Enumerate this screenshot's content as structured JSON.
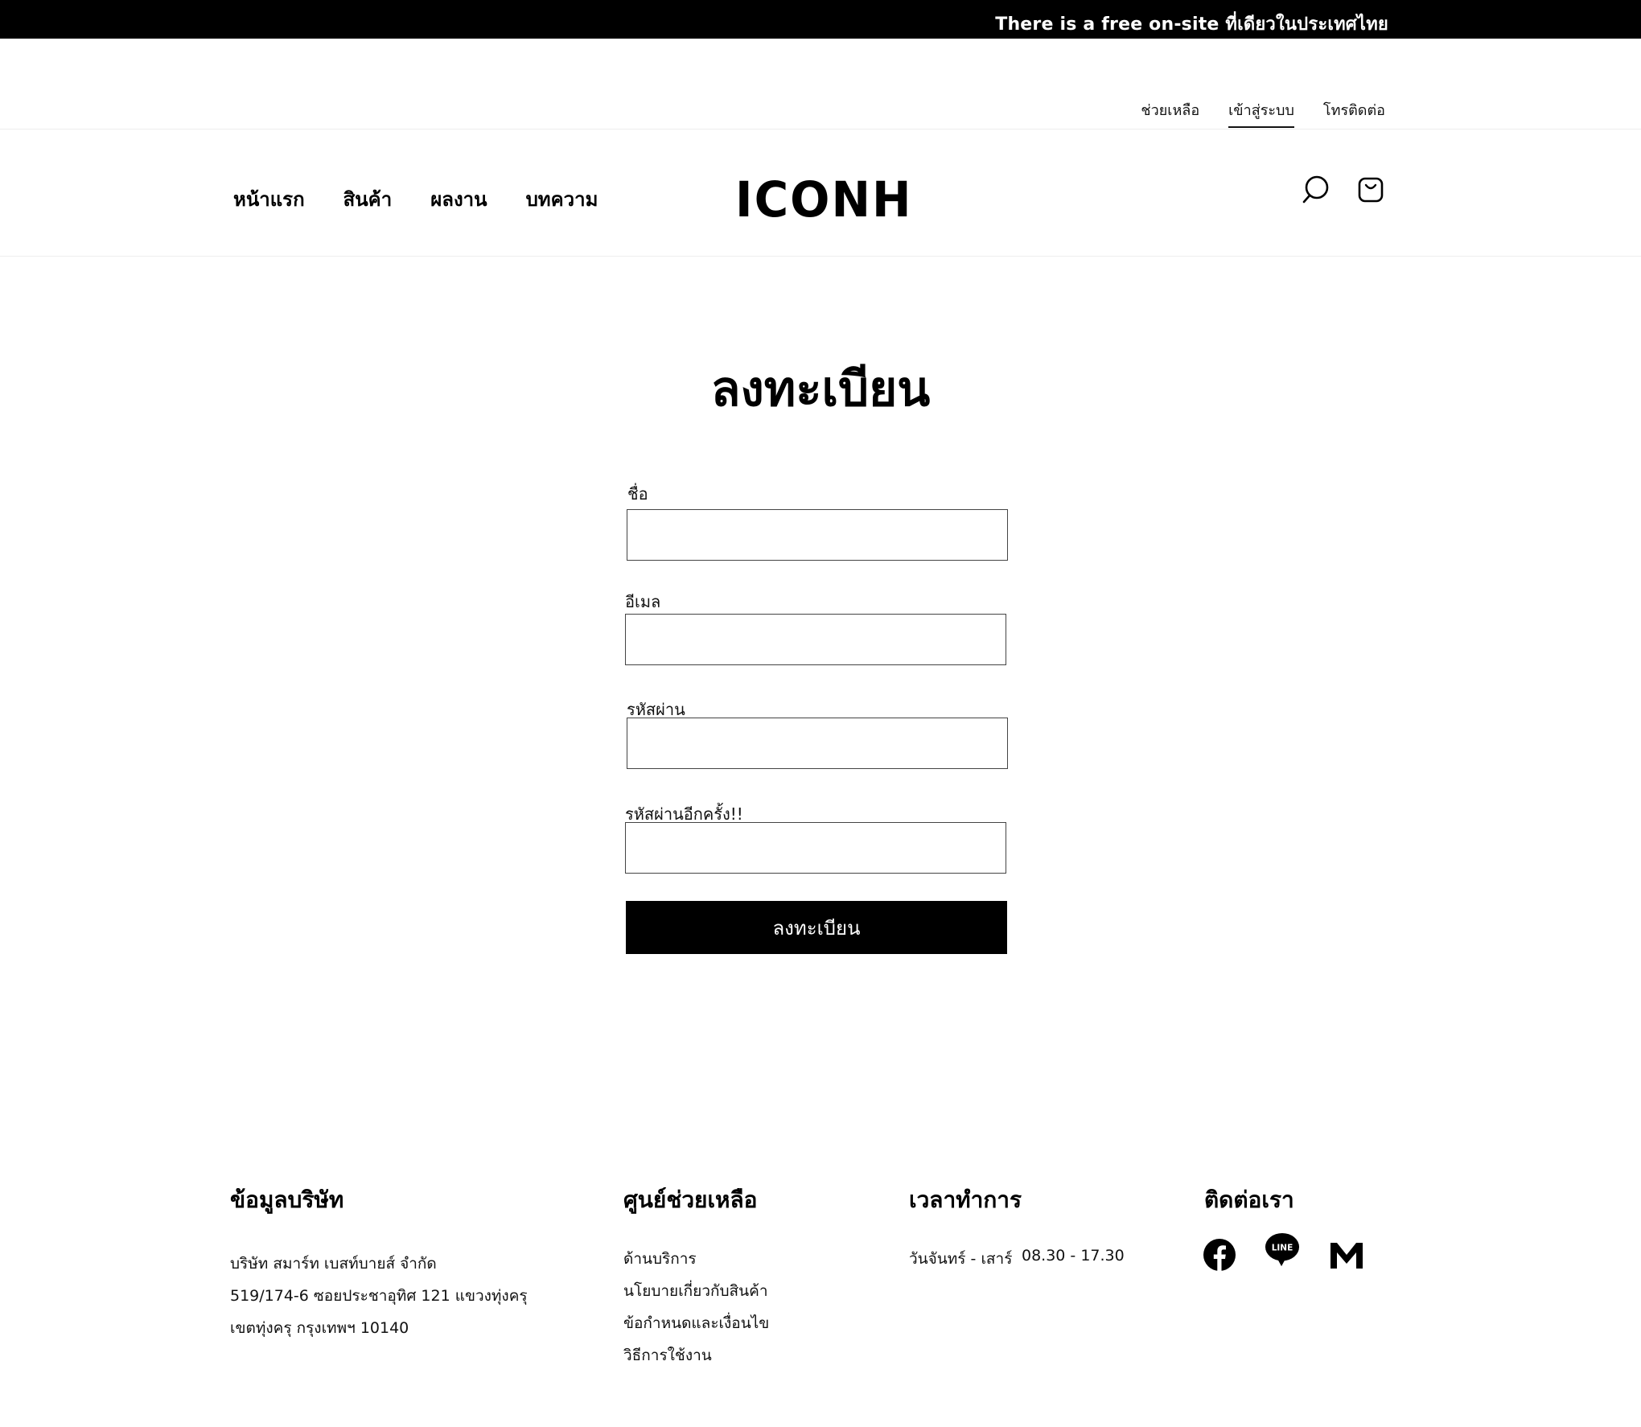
{
  "announcement": {
    "text": "There is a free on-site ที่เดียวในประเทศไทย"
  },
  "utility_nav": {
    "help": "ช่วยเหลือ",
    "login": "เข้าสู่ระบบ",
    "contact": "โทรติดต่อ"
  },
  "main_nav": {
    "home": "หน้าแรก",
    "products": "สินค้า",
    "portfolio": "ผลงาน",
    "articles": "บทความ"
  },
  "logo": {
    "text": "ICONH"
  },
  "header_icons": [
    "search-icon",
    "shopping-bag-icon"
  ],
  "form": {
    "title": "ลงทะเบียน",
    "name_label": "ชื่อ",
    "name_value": "",
    "email_label": "อีเมล",
    "email_value": "",
    "password_label": "รหัสผ่าน",
    "password_value": "",
    "confirm_label": "รหัสผ่านอีกครั้ง!!",
    "confirm_value": "",
    "submit_label": "ลงทะเบียน"
  },
  "footer": {
    "company": {
      "heading": "ข้อมูลบริษัท",
      "line1": "บริษัท สมาร์ท เบสท์บายส์ จำกัด",
      "line2": "519/174-6 ซอยประชาอุทิศ 121 แขวงทุ่งครุ",
      "line3": "เขตทุ่งครุ กรุงเทพฯ 10140"
    },
    "help": {
      "heading": "ศูนย์ช่วยเหลือ",
      "links": [
        "ด้านบริการ",
        "นโยบายเกี่ยวกับสินค้า",
        "ข้อกำหนดและเงื่อนไข",
        "วิธีการใช้งาน"
      ]
    },
    "hours": {
      "heading": "เวลาทำการ",
      "days": "วันจันทร์ - เสาร์",
      "time": "08.30 -  17.30"
    },
    "contact": {
      "heading": "ติดต่อเรา",
      "icons": [
        "facebook-icon",
        "line-icon",
        "gmail-icon"
      ],
      "line_badge": "LINE"
    }
  }
}
